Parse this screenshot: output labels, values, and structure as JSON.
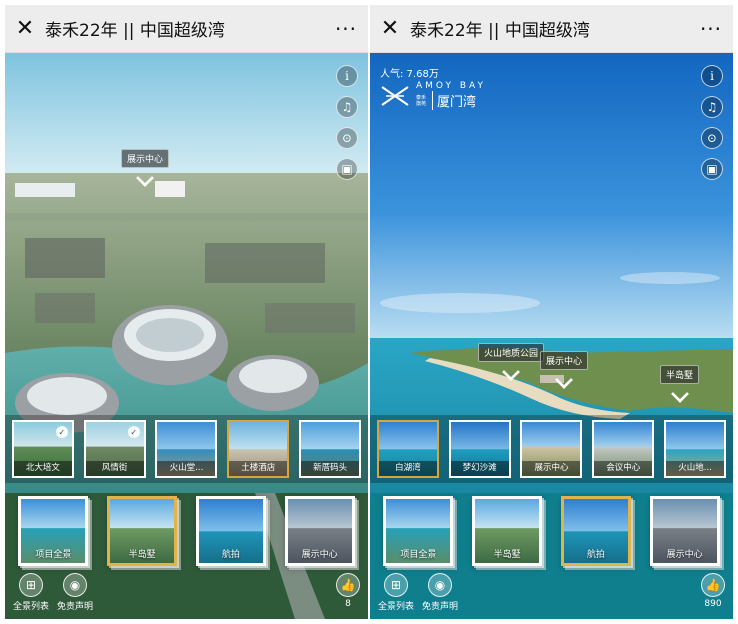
{
  "left": {
    "titlebar": {
      "close_icon": "close-icon",
      "title": "泰禾22年 || 中国超级湾",
      "more": "···"
    },
    "side_icons": [
      "info-icon",
      "music-icon",
      "vr-icon",
      "gyroscope-icon"
    ],
    "side_icon_glyphs": [
      "i",
      "♫",
      "⊙",
      "▣"
    ],
    "hotspots": [
      {
        "label": "展示中心"
      }
    ],
    "strip1": [
      {
        "label": "北大培文",
        "checked": true,
        "selected": false
      },
      {
        "label": "风情街",
        "checked": true,
        "selected": false
      },
      {
        "label": "火山堂...",
        "checked": false,
        "selected": false
      },
      {
        "label": "土楼酒店",
        "checked": false,
        "selected": true
      },
      {
        "label": "新厝码头",
        "checked": false,
        "selected": false
      }
    ],
    "strip2": [
      {
        "label": "项目全景",
        "selected": false
      },
      {
        "label": "半岛墅",
        "selected": true
      },
      {
        "label": "航拍",
        "selected": false
      },
      {
        "label": "展示中心",
        "selected": false
      }
    ],
    "bottom": {
      "list_label": "全景列表",
      "disclaimer_label": "免责声明",
      "like_count": "8"
    }
  },
  "right": {
    "titlebar": {
      "close_icon": "close-icon",
      "title": "泰禾22年 || 中国超级湾",
      "more": "···"
    },
    "popularity": "人气: 7.68万",
    "logo": {
      "en": "AMOY BAY",
      "small": "泰禾 旗苑",
      "cn": "厦门湾"
    },
    "side_icons": [
      "info-icon",
      "music-icon",
      "vr-icon",
      "gyroscope-icon"
    ],
    "side_icon_glyphs": [
      "i",
      "♫",
      "⊙",
      "▣"
    ],
    "hotspots": [
      {
        "label": "火山地质公园"
      },
      {
        "label": "展示中心"
      },
      {
        "label": "半岛墅"
      }
    ],
    "strip1": [
      {
        "label": "白湖湾",
        "selected": true
      },
      {
        "label": "梦幻沙滩",
        "selected": false
      },
      {
        "label": "展示中心",
        "selected": false
      },
      {
        "label": "会议中心",
        "selected": false
      },
      {
        "label": "火山地...",
        "selected": false
      }
    ],
    "strip2": [
      {
        "label": "项目全景",
        "selected": false
      },
      {
        "label": "半岛墅",
        "selected": false
      },
      {
        "label": "航拍",
        "selected": true
      },
      {
        "label": "展示中心",
        "selected": false
      }
    ],
    "bottom": {
      "list_label": "全景列表",
      "disclaimer_label": "免责声明",
      "like_count": "890"
    }
  }
}
